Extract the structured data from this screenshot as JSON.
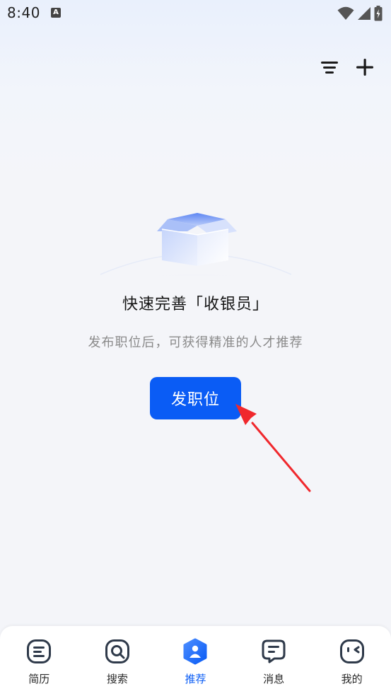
{
  "status_bar": {
    "time": "8:40",
    "notification_badge": "A"
  },
  "top_actions": {
    "icons": [
      "filter-icon",
      "plus-icon"
    ]
  },
  "empty_state": {
    "title": "快速完善「收银员」",
    "description": "发布职位后，可获得精准的人才推荐",
    "button_label": "发职位"
  },
  "bottom_nav": {
    "items": [
      {
        "label": "简历",
        "icon": "resume-icon"
      },
      {
        "label": "搜索",
        "icon": "search-icon"
      },
      {
        "label": "推荐",
        "icon": "recommend-icon"
      },
      {
        "label": "消息",
        "icon": "message-icon"
      },
      {
        "label": "我的",
        "icon": "profile-icon"
      }
    ],
    "active_index": 2
  },
  "colors": {
    "accent": "#0a5cf5",
    "arrow": "#f0282d",
    "text_muted": "#8a8a8a"
  }
}
